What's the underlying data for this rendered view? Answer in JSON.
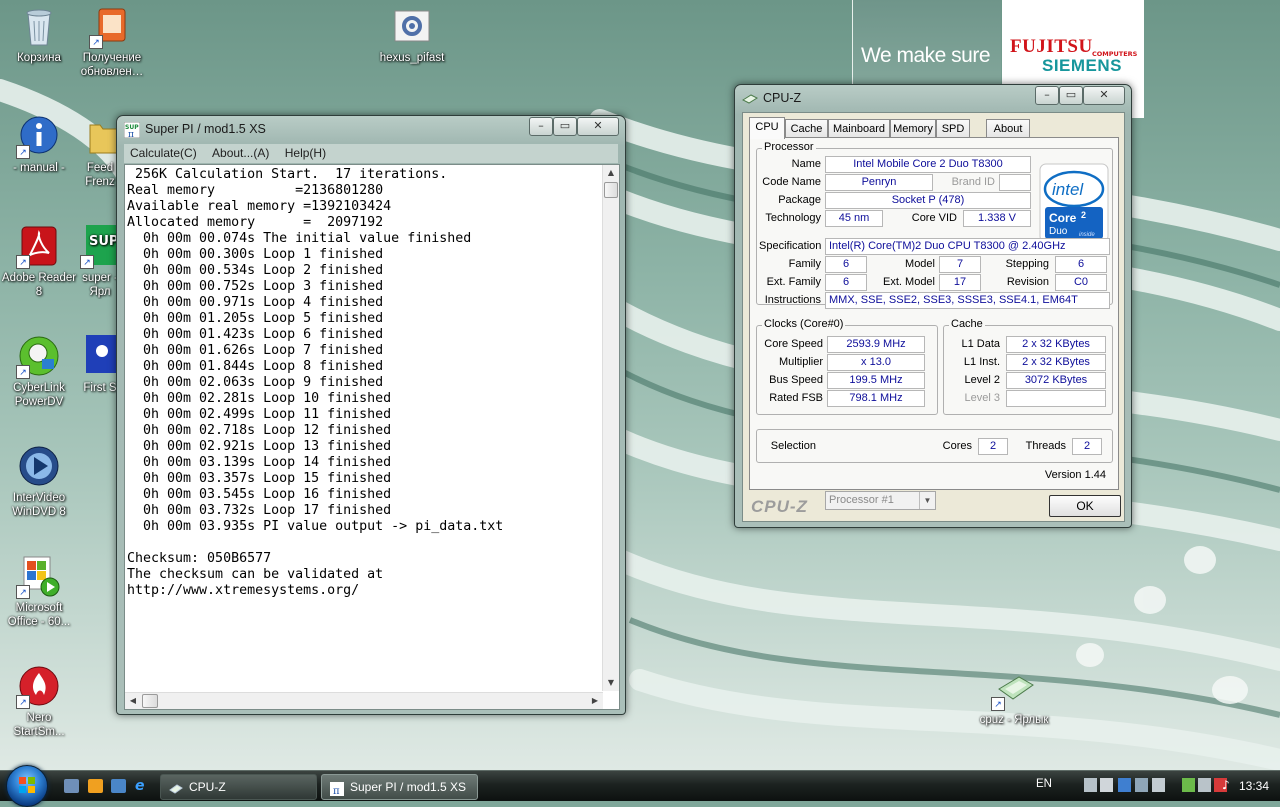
{
  "desktop": {
    "banner": {
      "slogan": "We make sure",
      "brand_line1": "FUJITSU",
      "brand_computers": "COMPUTERS",
      "brand_line2": "SIEMENS"
    },
    "icons": [
      {
        "name": "recycle-bin",
        "label": "Корзина"
      },
      {
        "name": "updates",
        "label": "Получение обновлен…"
      },
      {
        "name": "hexus-pifast",
        "label": "hexus_pifast"
      },
      {
        "name": "manual",
        "label": "- manual -"
      },
      {
        "name": "feed",
        "label": "Feed Frenz"
      },
      {
        "name": "adobe-reader",
        "label": "Adobe Reader 8"
      },
      {
        "name": "superpi-shortcut",
        "label": "super - Ярл"
      },
      {
        "name": "cyberlink",
        "label": "CyberLink PowerDV"
      },
      {
        "name": "first-steps",
        "label": "First S"
      },
      {
        "name": "windvd",
        "label": "InterVideo WinDVD 8"
      },
      {
        "name": "ms-office",
        "label": "Microsoft Office - 60..."
      },
      {
        "name": "nero",
        "label": "Nero StartSm..."
      },
      {
        "name": "cpuz-shortcut",
        "label": "cpuz - Ярлык"
      }
    ]
  },
  "superpi": {
    "title": "Super PI / mod1.5 XS",
    "menu": [
      "Calculate(C)",
      "About...(A)",
      "Help(H)"
    ],
    "output": " 256K Calculation Start.  17 iterations.\nReal memory          =2136801280\nAvailable real memory =1392103424\nAllocated memory      =  2097192\n  0h 00m 00.074s The initial value finished\n  0h 00m 00.300s Loop 1 finished\n  0h 00m 00.534s Loop 2 finished\n  0h 00m 00.752s Loop 3 finished\n  0h 00m 00.971s Loop 4 finished\n  0h 00m 01.205s Loop 5 finished\n  0h 00m 01.423s Loop 6 finished\n  0h 00m 01.626s Loop 7 finished\n  0h 00m 01.844s Loop 8 finished\n  0h 00m 02.063s Loop 9 finished\n  0h 00m 02.281s Loop 10 finished\n  0h 00m 02.499s Loop 11 finished\n  0h 00m 02.718s Loop 12 finished\n  0h 00m 02.921s Loop 13 finished\n  0h 00m 03.139s Loop 14 finished\n  0h 00m 03.357s Loop 15 finished\n  0h 00m 03.545s Loop 16 finished\n  0h 00m 03.732s Loop 17 finished\n  0h 00m 03.935s PI value output -> pi_data.txt\n\nChecksum: 050B6577\nThe checksum can be validated at\nhttp://www.xtremesystems.org/"
  },
  "cpuz": {
    "title": "CPU-Z",
    "tabs": [
      "CPU",
      "Cache",
      "Mainboard",
      "Memory",
      "SPD",
      "About"
    ],
    "active_tab": "CPU",
    "processor": {
      "group": "Processor",
      "name_label": "Name",
      "name": "Intel Mobile Core 2 Duo T8300",
      "codename_label": "Code Name",
      "codename": "Penryn",
      "brandid_label": "Brand ID",
      "package_label": "Package",
      "package": "Socket P (478)",
      "technology_label": "Technology",
      "technology": "45 nm",
      "corevid_label": "Core VID",
      "corevid": "1.338 V",
      "spec_label": "Specification",
      "spec": "Intel(R) Core(TM)2 Duo CPU     T8300  @ 2.40GHz",
      "family_label": "Family",
      "family": "6",
      "model_label": "Model",
      "model": "7",
      "stepping_label": "Stepping",
      "stepping": "6",
      "extfamily_label": "Ext. Family",
      "extfamily": "6",
      "extmodel_label": "Ext. Model",
      "extmodel": "17",
      "revision_label": "Revision",
      "revision": "C0",
      "instructions_label": "Instructions",
      "instructions": "MMX, SSE, SSE2, SSE3, SSSE3, SSE4.1, EM64T",
      "logo": {
        "brand": "intel",
        "line1": "Core",
        "line1_sup": "2",
        "line2": "Duo",
        "inside": "inside"
      }
    },
    "clocks": {
      "group": "Clocks (Core#0)",
      "corespeed_label": "Core Speed",
      "corespeed": "2593.9 MHz",
      "multiplier_label": "Multiplier",
      "multiplier": "x 13.0",
      "busspeed_label": "Bus Speed",
      "busspeed": "199.5 MHz",
      "ratedfsb_label": "Rated FSB",
      "ratedfsb": "798.1 MHz"
    },
    "cache": {
      "group": "Cache",
      "l1data_label": "L1 Data",
      "l1data": "2 x 32 KBytes",
      "l1inst_label": "L1 Inst.",
      "l1inst": "2 x 32 KBytes",
      "level2_label": "Level 2",
      "level2": "3072 KBytes",
      "level3_label": "Level 3"
    },
    "selection_label": "Selection",
    "selection": "Processor #1",
    "cores_label": "Cores",
    "cores": "2",
    "threads_label": "Threads",
    "threads": "2",
    "version": "Version 1.44",
    "brand": "CPU-Z",
    "ok": "OK"
  },
  "taskbar": {
    "buttons": [
      {
        "label": "CPU-Z",
        "active": false
      },
      {
        "label": "Super PI / mod1.5 XS",
        "active": true
      }
    ],
    "language": "EN",
    "clock": "13:34"
  }
}
